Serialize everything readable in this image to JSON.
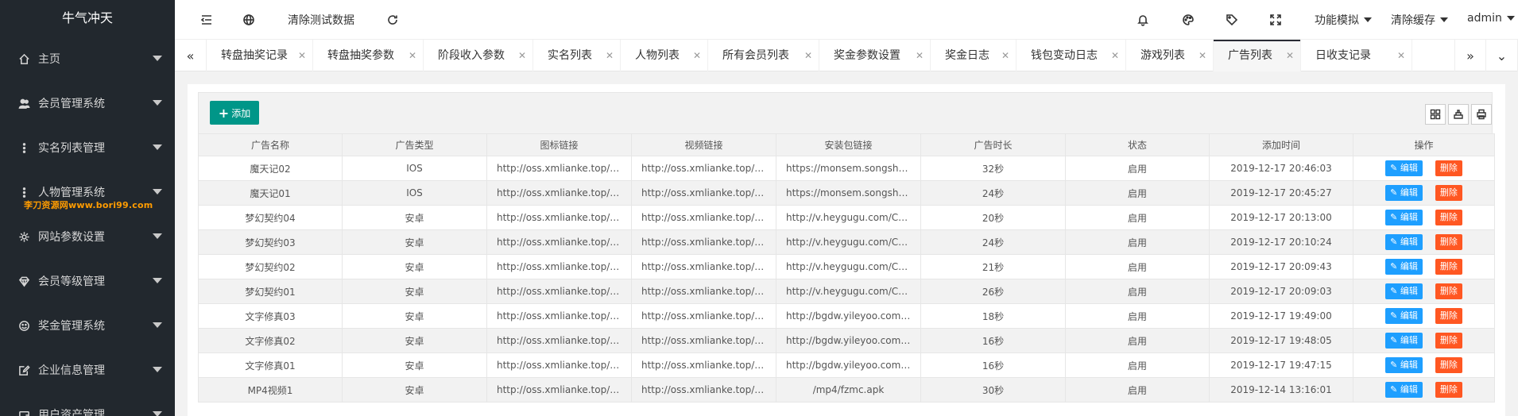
{
  "app": {
    "logo_text": "牛气冲天",
    "watermark": "李刀资源网www.bori99.com"
  },
  "sidebar": {
    "items": [
      {
        "label": "主页",
        "icon": "home-icon"
      },
      {
        "label": "会员管理系统",
        "icon": "users-icon"
      },
      {
        "label": "实名列表管理",
        "icon": "more-vertical-icon"
      },
      {
        "label": "人物管理系统",
        "icon": "more-vertical-icon"
      },
      {
        "label": "网站参数设置",
        "icon": "gear-icon"
      },
      {
        "label": "会员等级管理",
        "icon": "diamond-icon"
      },
      {
        "label": "奖金管理系统",
        "icon": "smile-icon"
      },
      {
        "label": "企业信息管理",
        "icon": "edit-icon"
      },
      {
        "label": "用户资产管理",
        "icon": "wallet-icon"
      }
    ]
  },
  "header": {
    "clear_test_data": "清除测试数据",
    "func_mode": "功能模拟",
    "clear_cache": "清除缓存",
    "user": "admin"
  },
  "tabs": [
    {
      "label": "转盘抽奖记录"
    },
    {
      "label": "转盘抽奖参数"
    },
    {
      "label": "阶段收入参数"
    },
    {
      "label": "实名列表"
    },
    {
      "label": "人物列表"
    },
    {
      "label": "所有会员列表"
    },
    {
      "label": "奖金参数设置"
    },
    {
      "label": "奖金日志"
    },
    {
      "label": "钱包变动日志"
    },
    {
      "label": "游戏列表"
    },
    {
      "label": "广告列表",
      "active": true
    },
    {
      "label": "日收支记录"
    }
  ],
  "toolbar": {
    "add_label": "添加"
  },
  "table": {
    "columns": [
      "广告名称",
      "广告类型",
      "图标链接",
      "视频链接",
      "安装包链接",
      "广告时长",
      "状态",
      "添加时间",
      "操作"
    ],
    "edit_label": "编辑",
    "delete_label": "删除",
    "rows": [
      {
        "name": "魔天记02",
        "type": "IOS",
        "icon_url": "http://oss.xmlianke.top/m...",
        "video_url": "http://oss.xmlianke.top/m...",
        "pkg_url": "https://monsem.songshug...",
        "duration": "32秒",
        "status": "启用",
        "time": "2019-12-17 20:46:03"
      },
      {
        "name": "魔天记01",
        "type": "IOS",
        "icon_url": "http://oss.xmlianke.top/m...",
        "video_url": "http://oss.xmlianke.top/m...",
        "pkg_url": "https://monsem.songshug...",
        "duration": "24秒",
        "status": "启用",
        "time": "2019-12-17 20:45:27"
      },
      {
        "name": "梦幻契约04",
        "type": "安卓",
        "icon_url": "http://oss.xmlianke.top/m...",
        "video_url": "http://oss.xmlianke.top/m...",
        "pkg_url": "http://v.heygugu.com/CPA...",
        "duration": "20秒",
        "status": "启用",
        "time": "2019-12-17 20:13:00"
      },
      {
        "name": "梦幻契约03",
        "type": "安卓",
        "icon_url": "http://oss.xmlianke.top/m...",
        "video_url": "http://oss.xmlianke.top/m...",
        "pkg_url": "http://v.heygugu.com/CPA...",
        "duration": "24秒",
        "status": "启用",
        "time": "2019-12-17 20:10:24"
      },
      {
        "name": "梦幻契约02",
        "type": "安卓",
        "icon_url": "http://oss.xmlianke.top/m...",
        "video_url": "http://oss.xmlianke.top/m...",
        "pkg_url": "http://v.heygugu.com/CPA...",
        "duration": "21秒",
        "status": "启用",
        "time": "2019-12-17 20:09:43"
      },
      {
        "name": "梦幻契约01",
        "type": "安卓",
        "icon_url": "http://oss.xmlianke.top/m...",
        "video_url": "http://oss.xmlianke.top/m...",
        "pkg_url": "http://v.heygugu.com/CPA...",
        "duration": "26秒",
        "status": "启用",
        "time": "2019-12-17 20:09:03"
      },
      {
        "name": "文字修真03",
        "type": "安卓",
        "icon_url": "http://oss.xmlianke.top/we...",
        "video_url": "http://oss.xmlianke.top/we...",
        "pkg_url": "http://bgdw.yileyoo.com/Yi...",
        "duration": "18秒",
        "status": "启用",
        "time": "2019-12-17 19:49:00"
      },
      {
        "name": "文字修真02",
        "type": "安卓",
        "icon_url": "http://oss.xmlianke.top/we...",
        "video_url": "http://oss.xmlianke.top/we...",
        "pkg_url": "http://bgdw.yileyoo.com/Yi...",
        "duration": "16秒",
        "status": "启用",
        "time": "2019-12-17 19:48:05"
      },
      {
        "name": "文字修真01",
        "type": "安卓",
        "icon_url": "http://oss.xmlianke.top/we...",
        "video_url": "http://oss.xmlianke.top/we...",
        "pkg_url": "http://bgdw.yileyoo.com/Yi...",
        "duration": "16秒",
        "status": "启用",
        "time": "2019-12-17 19:47:15"
      },
      {
        "name": "MP4视频1",
        "type": "安卓",
        "icon_url": "http://oss.xmlianke.top/%...",
        "video_url": "http://oss.xmlianke.top/%...",
        "pkg_url": "/mp4/fzmc.apk",
        "duration": "30秒",
        "status": "启用",
        "time": "2019-12-14 13:16:01"
      }
    ]
  }
}
